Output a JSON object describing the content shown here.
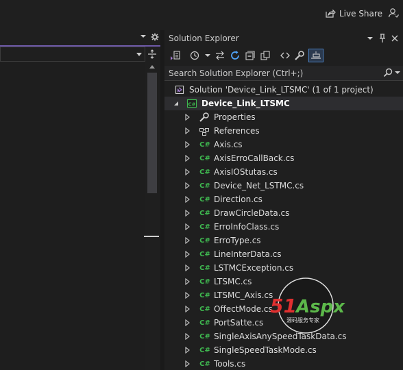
{
  "topbar": {
    "live_share": "Live Share"
  },
  "solution_explorer": {
    "title": "Solution Explorer",
    "search_placeholder": "Search Solution Explorer (Ctrl+;)",
    "solution_label": "Solution 'Device_Link_LTSMC' (1 of 1 project)",
    "project_label": "Device_Link_LTSMC",
    "items": [
      {
        "label": "Properties",
        "icon": "wrench-icon"
      },
      {
        "label": "References",
        "icon": "references-icon"
      },
      {
        "label": "Axis.cs",
        "icon": "csharp-file-icon"
      },
      {
        "label": "AxisErroCallBack.cs",
        "icon": "csharp-file-icon"
      },
      {
        "label": "AxisIOStutas.cs",
        "icon": "csharp-file-icon"
      },
      {
        "label": "Device_Net_LSTMC.cs",
        "icon": "csharp-file-icon"
      },
      {
        "label": "Direction.cs",
        "icon": "csharp-file-icon"
      },
      {
        "label": "DrawCircleData.cs",
        "icon": "csharp-file-icon"
      },
      {
        "label": "ErroInfoClass.cs",
        "icon": "csharp-file-icon"
      },
      {
        "label": "ErroType.cs",
        "icon": "csharp-file-icon"
      },
      {
        "label": "LineInterData.cs",
        "icon": "csharp-file-icon"
      },
      {
        "label": "LSTMCException.cs",
        "icon": "csharp-file-icon"
      },
      {
        "label": "LTSMC.cs",
        "icon": "csharp-file-icon"
      },
      {
        "label": "LTSMC_Axis.cs",
        "icon": "csharp-file-icon"
      },
      {
        "label": "OffectMode.cs",
        "icon": "csharp-file-icon"
      },
      {
        "label": "PortSatte.cs",
        "icon": "csharp-file-icon"
      },
      {
        "label": "SingleAxisAnySpeedTaskData.cs",
        "icon": "csharp-file-icon"
      },
      {
        "label": "SingleSpeedTaskMode.cs",
        "icon": "csharp-file-icon"
      },
      {
        "label": "Tools.cs",
        "icon": "csharp-file-icon"
      }
    ],
    "csharp_badge": "C#"
  },
  "watermark": {
    "brand": "51Aspx",
    "subtitle": "源码服务专家"
  },
  "colors": {
    "accent": "#6e5aa8",
    "csharp": "#3fb950",
    "selected_row": "#2d2d30",
    "watermark_red": "#e03030",
    "watermark_green": "#5cb84a"
  }
}
